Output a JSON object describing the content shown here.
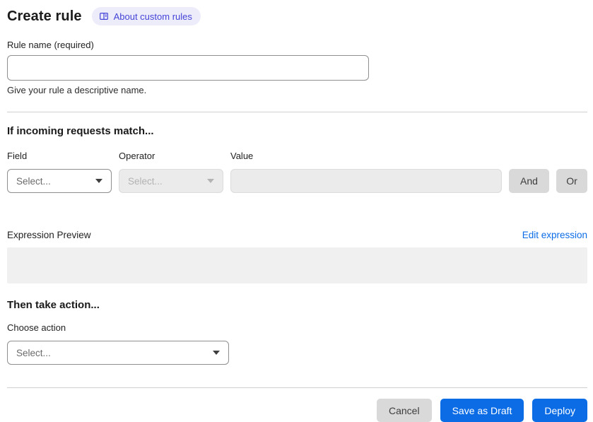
{
  "header": {
    "title": "Create rule",
    "badge": {
      "label": "About custom rules",
      "icon": "book-icon"
    }
  },
  "rule_name": {
    "label": "Rule name (required)",
    "value": "",
    "placeholder": "",
    "helper": "Give your rule a descriptive name."
  },
  "match_section": {
    "heading": "If incoming requests match...",
    "field": {
      "label": "Field",
      "selected": "Select..."
    },
    "operator": {
      "label": "Operator",
      "selected": "Select...",
      "disabled": true
    },
    "value": {
      "label": "Value",
      "value": "",
      "disabled": true
    },
    "and_button": "And",
    "or_button": "Or"
  },
  "expression": {
    "label": "Expression Preview",
    "edit_link": "Edit expression",
    "preview": ""
  },
  "action_section": {
    "heading": "Then take action...",
    "choose_label": "Choose action",
    "selected": "Select..."
  },
  "footer": {
    "cancel": "Cancel",
    "save_draft": "Save as Draft",
    "deploy": "Deploy"
  },
  "colors": {
    "accent_blue": "#0b6ce6",
    "badge_bg": "#edecfb",
    "badge_text": "#4544d7",
    "disabled_bg": "#ebebeb",
    "gray_button": "#d9d9d9",
    "preview_bg": "#f0f0f0"
  }
}
